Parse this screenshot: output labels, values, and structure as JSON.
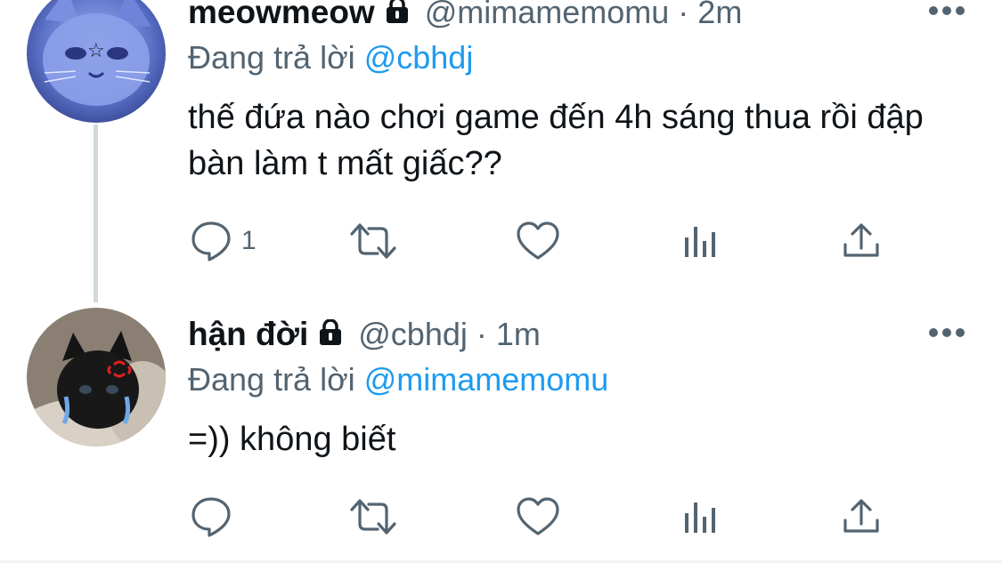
{
  "tweets": [
    {
      "display_name": "meowmeow",
      "handle": "@mimamemomu",
      "separator": "·",
      "time": "2m",
      "replying_prefix": "Đang trả lời",
      "replying_to": "@cbhdj",
      "text": "thế đứa nào chơi game đến 4h sáng thua rồi đập bàn làm t mất giấc??",
      "reply_count": "1",
      "protected": true
    },
    {
      "display_name": "hận đời",
      "handle": "@cbhdj",
      "separator": "·",
      "time": "1m",
      "replying_prefix": "Đang trả lời",
      "replying_to": "@mimamemomu",
      "text": "=)) không biết",
      "reply_count": "",
      "protected": true
    }
  ],
  "colors": {
    "primary_text": "#0f1419",
    "secondary_text": "#536471",
    "accent": "#1d9bf0",
    "thread_line": "#cfd9de"
  },
  "icons": [
    "reply-icon",
    "retweet-icon",
    "like-icon",
    "analytics-icon",
    "share-icon",
    "lock-icon",
    "more-icon"
  ]
}
